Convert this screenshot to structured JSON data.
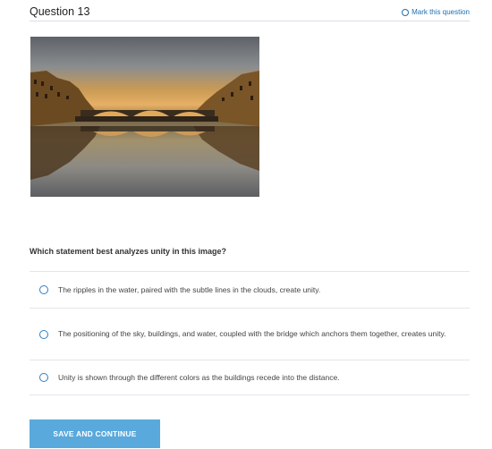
{
  "header": {
    "question_title": "Question 13",
    "mark_label": "Mark this question"
  },
  "question": {
    "prompt": "Which statement best analyzes unity in this image?",
    "options": [
      {
        "label": "The ripples in the water, paired with the subtle lines in the clouds, create unity."
      },
      {
        "label": "The positioning of the sky, buildings, and water, coupled with the bridge which anchors them together, creates unity."
      },
      {
        "label": "Unity is shown through the different colors as the buildings recede into the distance."
      }
    ]
  },
  "actions": {
    "submit_label": "SAVE AND CONTINUE"
  },
  "colors": {
    "accent": "#2f7ec1",
    "button": "#5aa9dc",
    "link": "#1f6fb3"
  }
}
